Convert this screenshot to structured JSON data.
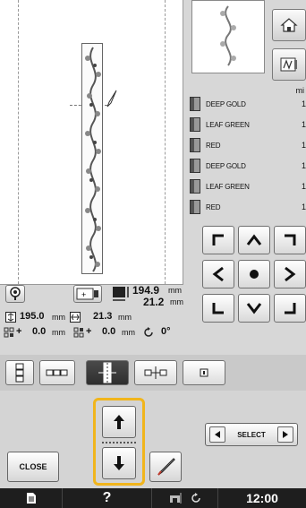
{
  "preview": {},
  "thread_list": {
    "min_label": "mi",
    "items": [
      {
        "name": "DEEP GOLD",
        "count": "1"
      },
      {
        "name": "LEAF GREEN",
        "count": "1"
      },
      {
        "name": "RED",
        "count": "1"
      },
      {
        "name": "DEEP GOLD",
        "count": "1"
      },
      {
        "name": "LEAF GREEN",
        "count": "1"
      },
      {
        "name": "RED",
        "count": "1"
      }
    ]
  },
  "info": {
    "size_h_value": "194.9",
    "size_h_unit": "mm",
    "size_w_value": "21.2",
    "size_w_unit": "mm",
    "pattern_h_value": "195.0",
    "pattern_h_unit": "mm",
    "pattern_w_value": "21.3",
    "pattern_w_unit": "mm",
    "offset_x_prefix": "+",
    "offset_x_value": "0.0",
    "offset_x_unit": "mm",
    "offset_y_prefix": "+",
    "offset_y_value": "0.0",
    "offset_y_unit": "mm",
    "rotation_value": "0°"
  },
  "select": {
    "label": "SELECT"
  },
  "close": {
    "label": "CLOSE"
  },
  "status": {
    "time": "12:00",
    "help": "?"
  }
}
